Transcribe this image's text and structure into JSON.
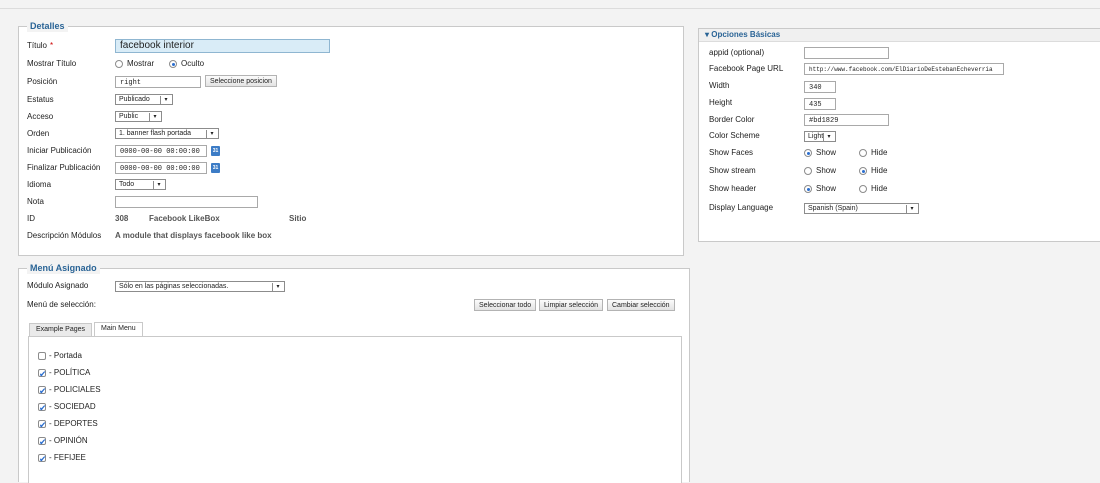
{
  "details": {
    "legend": "Detalles",
    "title_label": "Título",
    "required_mark": "*",
    "title_value": "facebook interior",
    "show_title_label": "Mostrar Título",
    "show_option": "Mostrar",
    "hide_option": "Oculto",
    "position_label": "Posición",
    "position_value": "right",
    "select_position_button": "Seleccione posicion",
    "status_label": "Estatus",
    "status_value": "Publicado",
    "access_label": "Acceso",
    "access_value": "Public",
    "order_label": "Orden",
    "order_value": "1. banner flash portada",
    "start_label": "Iniciar Publicación",
    "start_value": "0000-00-00 00:00:00",
    "end_label": "Finalizar Publicación",
    "end_value": "0000-00-00 00:00:00",
    "calendar_icon_text": "31",
    "language_label": "Idioma",
    "language_value": "Todo",
    "note_label": "Nota",
    "note_value": "",
    "id_label": "ID",
    "id_value": "308",
    "module_name": "Facebook LikeBox",
    "site_value": "Sitio",
    "description_label": "Descripción Módulos",
    "description_value": "A module that displays facebook like box"
  },
  "basic_options": {
    "header": "▾ Opciones Básicas",
    "appid_label": "appid (optional)",
    "appid_value": "",
    "page_url_label": "Facebook Page URL",
    "page_url_value": "http://www.facebook.com/ElDiarioDeEstebanEcheverria",
    "width_label": "Width",
    "width_value": "340",
    "height_label": "Height",
    "height_value": "435",
    "border_color_label": "Border Color",
    "border_color_value": "#bd1829",
    "color_scheme_label": "Color Scheme",
    "color_scheme_value": "Light",
    "show_faces_label": "Show Faces",
    "show_stream_label": "Show stream",
    "show_header_label": "Show header",
    "show_option": "Show",
    "hide_option": "Hide",
    "display_language_label": "Display Language",
    "display_language_value": "Spanish (Spain)"
  },
  "menu_assignment": {
    "legend": "Menú Asignado",
    "assigned_label": "Módulo Asignado",
    "assigned_value": "Sólo en las páginas seleccionadas.",
    "selection_label": "Menú de selección:",
    "select_all_button": "Seleccionar todo",
    "clear_button": "Limpiar selección",
    "toggle_button": "Cambiar selección",
    "tabs": [
      "Example Pages",
      "Main Menu"
    ],
    "items": [
      {
        "label": "- Portada",
        "checked": false
      },
      {
        "label": "- POLÍTICA",
        "checked": true
      },
      {
        "label": "- POLICIALES",
        "checked": true
      },
      {
        "label": "- SOCIEDAD",
        "checked": true
      },
      {
        "label": "- DEPORTES",
        "checked": true
      },
      {
        "label": "- OPINIÓN",
        "checked": true
      },
      {
        "label": "- FEFIJEE",
        "checked": true
      }
    ]
  },
  "colors": {
    "legend_blue": "#2a6496",
    "radio_blue": "#2a6ecf",
    "title_input_bg": "#d9ecf7"
  }
}
